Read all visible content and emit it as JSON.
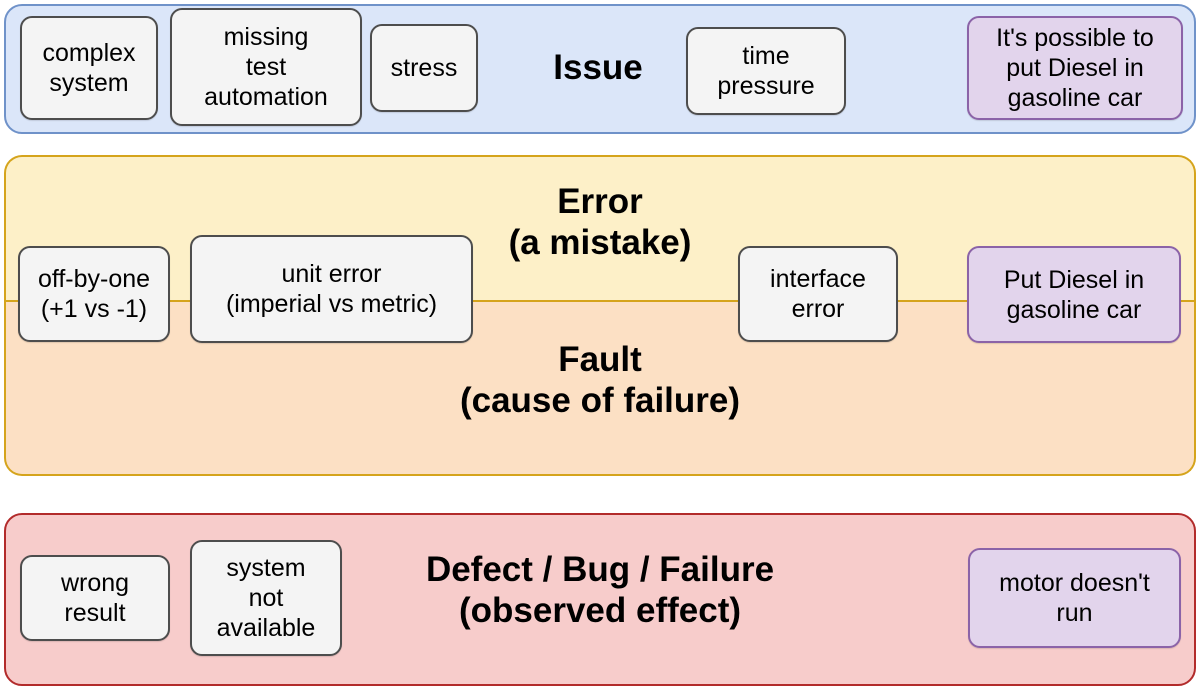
{
  "diagram": {
    "title": "Issue / Error / Fault / Defect terminology diagram",
    "bands": {
      "issue": {
        "caption": "Issue",
        "fill": "#dbe6f9",
        "border": "#6f92c9"
      },
      "error": {
        "caption": "Error\n(a mistake)",
        "fill": "#fdf0c8",
        "border": "#d5a41c"
      },
      "fault": {
        "caption": "Fault\n(cause of failure)",
        "fill": "#fce0c4",
        "border": "#d5a41c"
      },
      "defect": {
        "caption": "Defect / Bug / Failure\n(observed effect)",
        "fill": "#f7cccb",
        "border": "#b22b2b"
      }
    },
    "nodes": {
      "issue": [
        {
          "id": "complex-system",
          "label": "complex\nsystem",
          "style": "grey"
        },
        {
          "id": "missing-test-automation",
          "label": "missing\ntest\nautomation",
          "style": "grey"
        },
        {
          "id": "stress",
          "label": "stress",
          "style": "grey"
        },
        {
          "id": "time-pressure",
          "label": "time\npressure",
          "style": "grey"
        },
        {
          "id": "possible-put-diesel",
          "label": "It's possible to\nput Diesel in\ngasoline car",
          "style": "purple"
        }
      ],
      "error_fault": [
        {
          "id": "off-by-one",
          "label": "off-by-one\n(+1 vs -1)",
          "style": "grey"
        },
        {
          "id": "unit-error",
          "label": "unit error\n(imperial vs metric)",
          "style": "grey"
        },
        {
          "id": "interface-error",
          "label": "interface\nerror",
          "style": "grey"
        },
        {
          "id": "put-diesel",
          "label": "Put Diesel in\ngasoline car",
          "style": "purple"
        }
      ],
      "defect": [
        {
          "id": "wrong-result",
          "label": "wrong\nresult",
          "style": "grey"
        },
        {
          "id": "system-not-available",
          "label": "system\nnot\navailable",
          "style": "grey"
        },
        {
          "id": "motor-doesnt-run",
          "label": "motor doesn't\nrun",
          "style": "purple"
        }
      ]
    },
    "node_colors": {
      "grey_fill": "#f4f4f4",
      "grey_border": "#4d4d4d",
      "purple_fill": "#e2d4ec",
      "purple_border": "#8b63a8"
    }
  }
}
